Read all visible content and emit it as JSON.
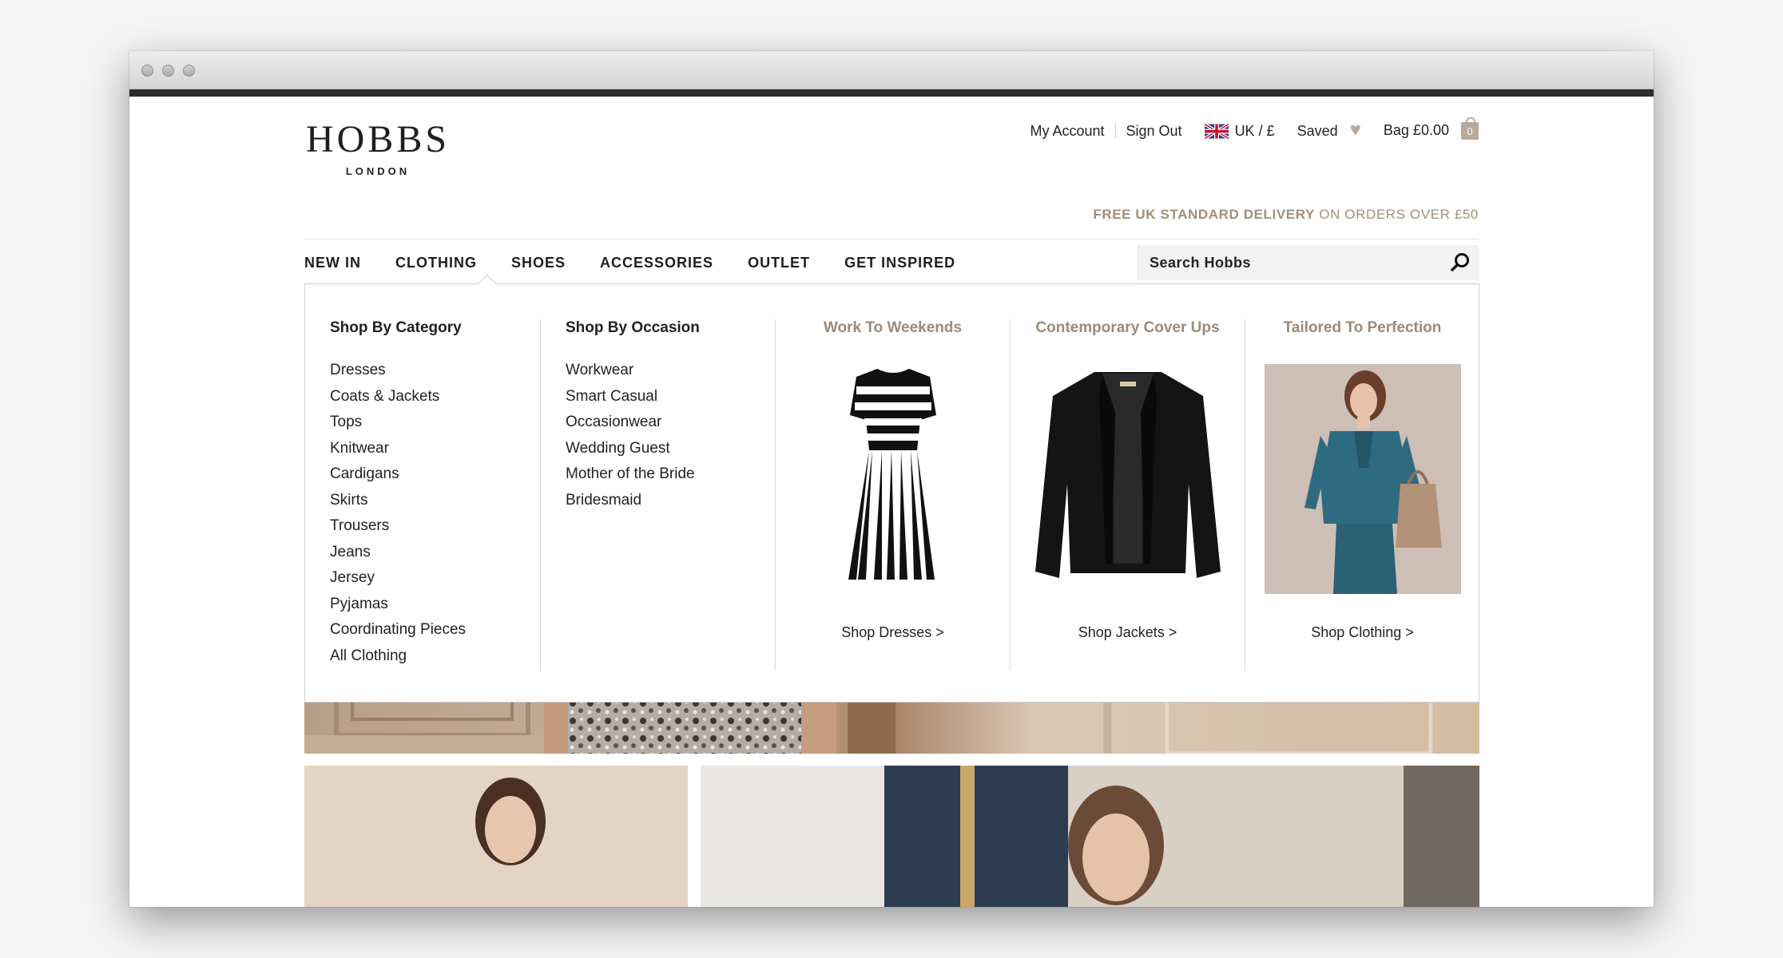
{
  "brand": {
    "name": "HOBBS",
    "sub": "LONDON"
  },
  "utility": {
    "my_account": "My Account",
    "sign_out": "Sign Out",
    "region": "UK / £",
    "saved": "Saved",
    "bag": "Bag £0.00",
    "bag_count": "0"
  },
  "delivery": {
    "strong": "FREE UK STANDARD DELIVERY",
    "rest": " ON ORDERS OVER £50"
  },
  "nav": {
    "items": [
      "NEW IN",
      "CLOTHING",
      "SHOES",
      "ACCESSORIES",
      "OUTLET",
      "GET INSPIRED"
    ],
    "active": "CLOTHING"
  },
  "search": {
    "placeholder": "Search Hobbs"
  },
  "mega": {
    "category": {
      "title": "Shop By Category",
      "items": [
        "Dresses",
        "Coats & Jackets",
        "Tops",
        "Knitwear",
        "Cardigans",
        "Skirts",
        "Trousers",
        "Jeans",
        "Jersey",
        "Pyjamas",
        "Coordinating Pieces",
        "All Clothing"
      ]
    },
    "occasion": {
      "title": "Shop By Occasion",
      "items": [
        "Workwear",
        "Smart Casual",
        "Occasionwear",
        "Wedding Guest",
        "Mother of the Bride",
        "Bridesmaid"
      ]
    },
    "features": [
      {
        "title": "Work To Weekends",
        "link": "Shop Dresses >"
      },
      {
        "title": "Contemporary Cover Ups",
        "link": "Shop Jackets >"
      },
      {
        "title": "Tailored To Perfection",
        "link": "Shop Clothing >"
      }
    ]
  },
  "colors": {
    "accent_tan": "#9c8a78",
    "text": "#222222",
    "chrome_dark": "#2b2b2b"
  }
}
